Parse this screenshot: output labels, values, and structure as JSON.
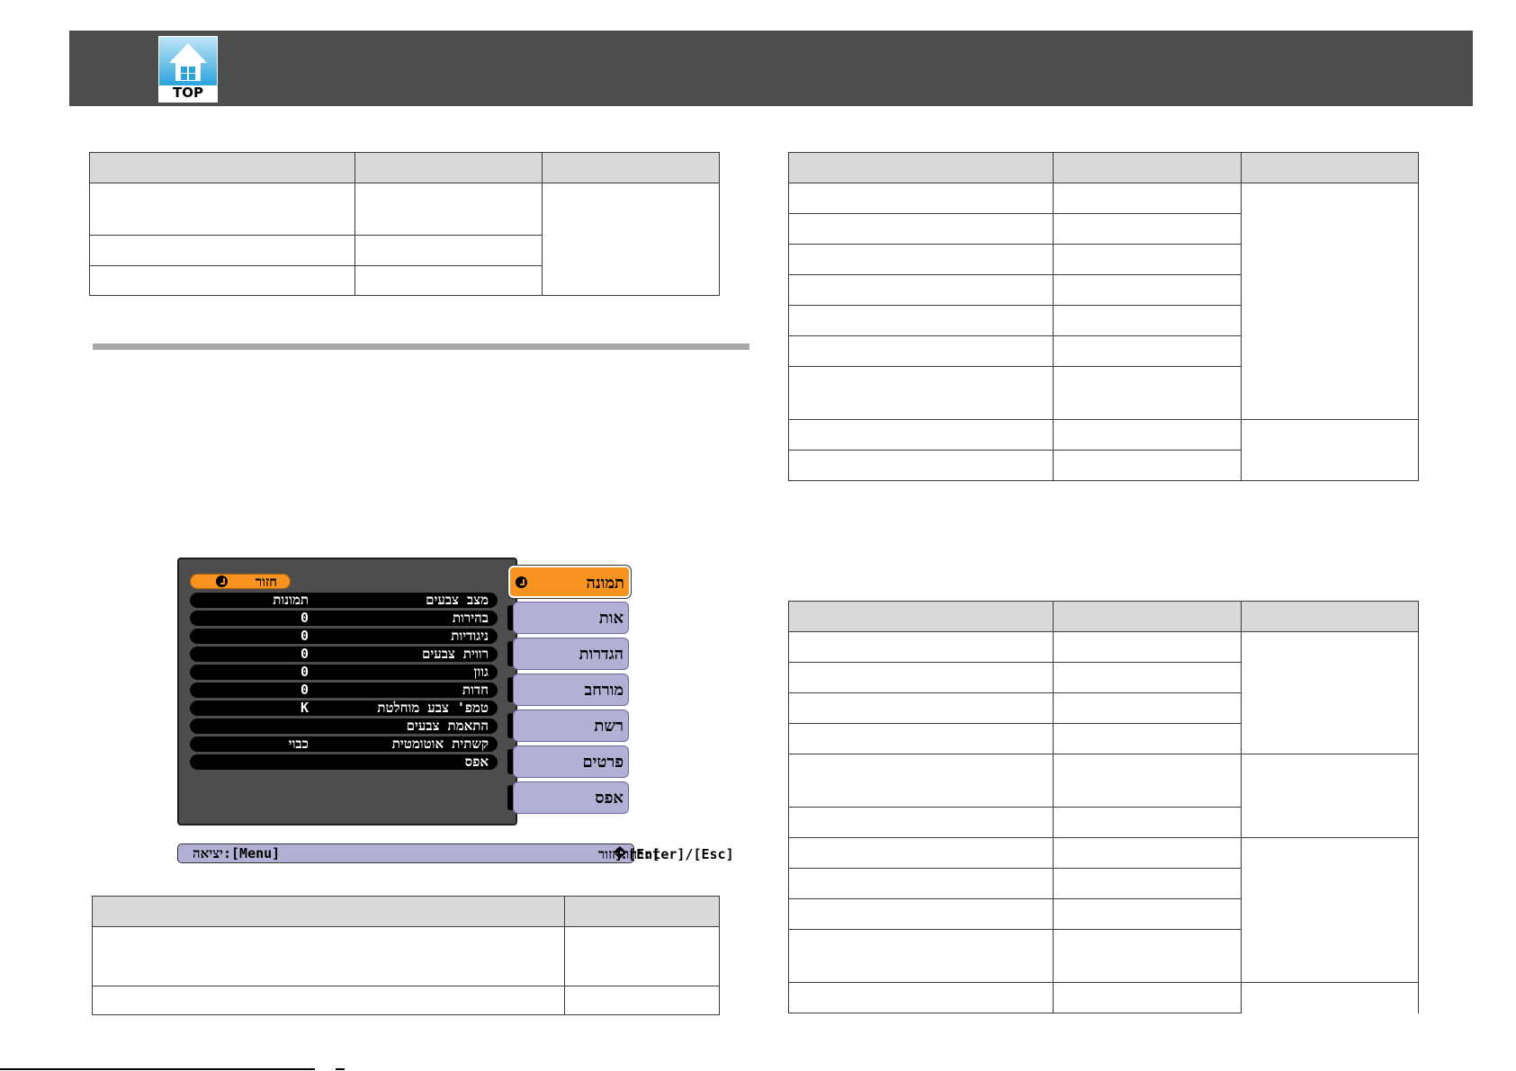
{
  "header": {
    "logo_text": "TOP"
  },
  "tables": {
    "t1": {
      "rows": [
        [
          "",
          "",
          ""
        ],
        [
          "",
          "",
          ""
        ],
        [
          "",
          ""
        ],
        [
          "",
          ""
        ]
      ]
    },
    "t2": {
      "rows": [
        [
          "",
          "",
          ""
        ],
        [
          "",
          "",
          ""
        ],
        [
          ""
        ],
        [
          ""
        ],
        [
          ""
        ],
        [
          ""
        ],
        [
          ""
        ],
        [
          ""
        ],
        [
          "",
          "",
          ""
        ],
        [
          "",
          ""
        ]
      ]
    },
    "t3": {
      "rows": [
        [
          "",
          "",
          ""
        ],
        [
          "",
          "",
          ""
        ],
        [
          "",
          ""
        ],
        [
          "",
          ""
        ],
        [
          "",
          ""
        ],
        [
          "",
          "",
          ""
        ],
        [
          "",
          ""
        ],
        [
          "",
          "",
          ""
        ],
        [
          "",
          ""
        ],
        [
          "",
          ""
        ],
        [
          "",
          ""
        ],
        [
          "",
          "",
          ""
        ]
      ]
    },
    "t4": {
      "rows": [
        [
          "",
          ""
        ],
        [
          "",
          ""
        ],
        [
          "",
          ""
        ]
      ]
    }
  },
  "projector_menu": {
    "back_label": "חזור",
    "items": [
      {
        "label": "מצב צבעים",
        "value": "תמונות"
      },
      {
        "label": "בהירות",
        "value": "0"
      },
      {
        "label": "ניגודיות",
        "value": "0"
      },
      {
        "label": "רווית צבעים",
        "value": "0"
      },
      {
        "label": "גוון",
        "value": "0"
      },
      {
        "label": "חדות",
        "value": "0"
      },
      {
        "label": "טמפ' צבע מוחלטת",
        "value": "K"
      },
      {
        "label": "התאמת צבעים",
        "value": ""
      },
      {
        "label": "קשתית אוטומטית",
        "value": "כבוי"
      },
      {
        "label": "אפס",
        "value": ""
      }
    ],
    "tabs": [
      {
        "label": "תמונה",
        "active": true
      },
      {
        "label": "אות",
        "active": false
      },
      {
        "label": "הגדרות",
        "active": false
      },
      {
        "label": "מורחב",
        "active": false
      },
      {
        "label": "רשת",
        "active": false
      },
      {
        "label": "פרטים",
        "active": false
      },
      {
        "label": "אפס",
        "active": false
      }
    ],
    "status_exit": "יציאה:[Menu]",
    "status_select": "בחר:[",
    "status_select_end": "]",
    "status_back": "חזור:[Enter]/[Esc]",
    "colors": {
      "accent": "#f7931e",
      "tab": "#b3b0d6",
      "panel": "#4d4d4d"
    }
  }
}
